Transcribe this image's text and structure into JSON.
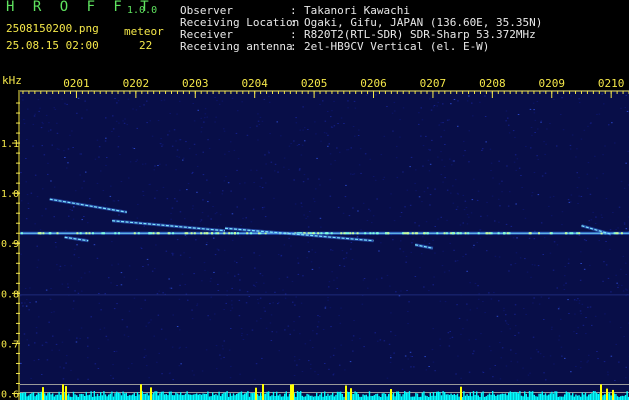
{
  "app": {
    "title": "H R O F F T",
    "version": "1.0.0"
  },
  "file_name": "2508150200.png",
  "datetime": "25.08.15 02:00",
  "meteor": {
    "label": "meteor",
    "count": "22"
  },
  "info": [
    {
      "key": "Observer",
      "value": "Takanori Kawachi"
    },
    {
      "key": "Receiving Location",
      "value": "Ogaki, Gifu, JAPAN (136.60E, 35.35N)"
    },
    {
      "key": "Receiver",
      "value": "R820T2(RTL-SDR) SDR-Sharp 53.372MHz"
    },
    {
      "key": "Receiving antenna",
      "value": "2el-HB9CV Vertical (el. E-W)"
    }
  ],
  "colors": {
    "text_yellow": "#f5e84a",
    "text_green": "#5fe35f",
    "background": "#000000",
    "spectrum_noise": "#0a1160",
    "echo": "#7fe6ff",
    "level_cyan": "#00ffff",
    "level_yellow": "#ffff00"
  },
  "chart_data": {
    "type": "heatmap",
    "ylabel": "kHz",
    "x_tick_labels": [
      "0201",
      "0202",
      "0203",
      "0204",
      "0205",
      "0206",
      "0207",
      "0208",
      "0209",
      "0210"
    ],
    "x_ticks_minutes": [
      1,
      2,
      3,
      4,
      5,
      6,
      7,
      8,
      9,
      10
    ],
    "x_range_minutes": [
      0.05,
      10.3
    ],
    "y_tick_labels": [
      "1.1",
      "1.0",
      "0.9",
      "0.8",
      "0.7",
      "0.6"
    ],
    "y_ticks": [
      1.1,
      1.0,
      0.9,
      0.8,
      0.7,
      0.6
    ],
    "ylim": [
      0.587,
      1.206
    ],
    "carrier_khz": 0.92,
    "reference_lines_khz": [
      0.797,
      0.618,
      0.602
    ],
    "echoes": [
      {
        "t": [
          0.55,
          1.85
        ],
        "f": [
          0.988,
          0.962
        ]
      },
      {
        "t": [
          1.6,
          3.5
        ],
        "f": [
          0.945,
          0.925
        ]
      },
      {
        "t": [
          3.5,
          6.0
        ],
        "f": [
          0.93,
          0.905
        ]
      },
      {
        "t": [
          0.8,
          1.2
        ],
        "f": [
          0.912,
          0.905
        ]
      },
      {
        "t": [
          6.7,
          7.0
        ],
        "f": [
          0.897,
          0.89
        ]
      },
      {
        "t": [
          9.5,
          10.0
        ],
        "f": [
          0.935,
          0.918
        ]
      }
    ]
  }
}
